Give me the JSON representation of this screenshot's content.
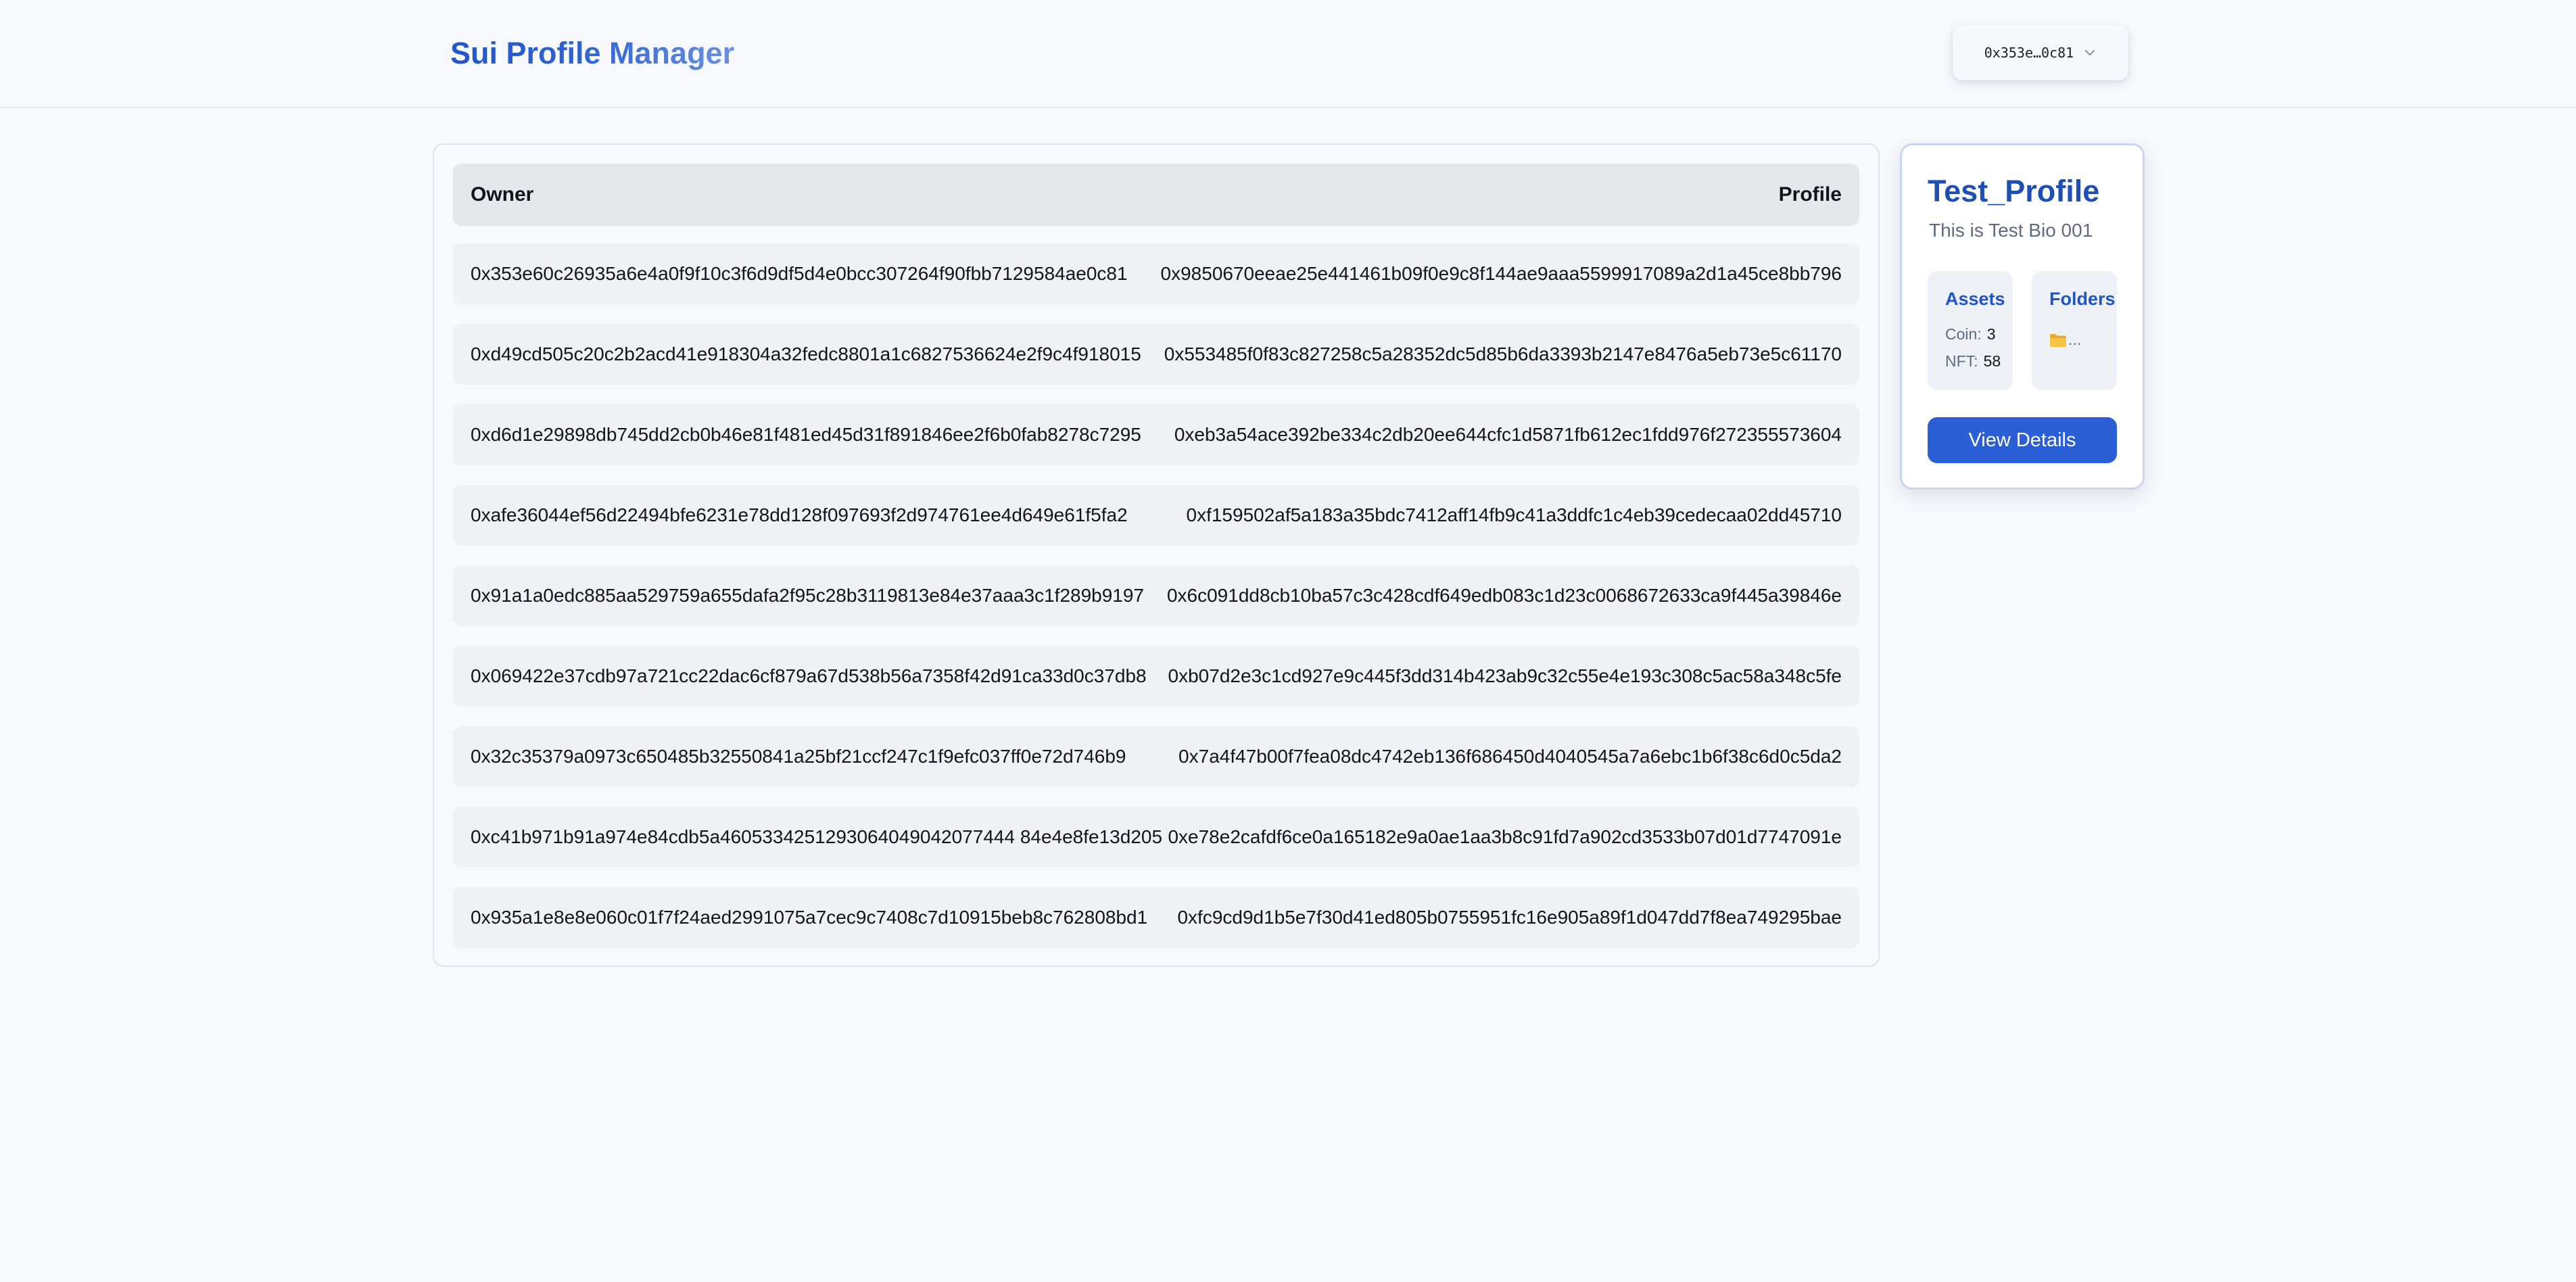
{
  "header": {
    "title": "Sui Profile Manager",
    "wallet_address": "0x353e…0c81",
    "wallet_icon": "chevron-down-icon"
  },
  "table": {
    "columns": [
      "Owner",
      "Profile"
    ],
    "rows": [
      {
        "owner": "0x353e60c26935a6e4a0f9f10c3f6d9df5d4e0bcc307264f90fbb7129584ae0c81",
        "profile": "0x9850670eeae25e441461b09f0e9c8f144ae9aaa5599917089a2d1a45ce8bb796"
      },
      {
        "owner": "0xd49cd505c20c2b2acd41e918304a32fedc8801a1c6827536624e2f9c4f918015",
        "profile": "0x553485f0f83c827258c5a28352dc5d85b6da3393b2147e8476a5eb73e5c61170"
      },
      {
        "owner": "0xd6d1e29898db745dd2cb0b46e81f481ed45d31f891846ee2f6b0fab8278c7295",
        "profile": "0xeb3a54ace392be334c2db20ee644cfc1d5871fb612ec1fdd976f272355573604"
      },
      {
        "owner": "0xafe36044ef56d22494bfe6231e78dd128f097693f2d974761ee4d649e61f5fa2",
        "profile": "0xf159502af5a183a35bdc7412aff14fb9c41a3ddfc1c4eb39cedecaa02dd45710"
      },
      {
        "owner": "0x91a1a0edc885aa529759a655dafa2f95c28b3119813e84e37aaa3c1f289b9197",
        "profile": "0x6c091dd8cb10ba57c3c428cdf649edb083c1d23c0068672633ca9f445a39846e"
      },
      {
        "owner": "0x069422e37cdb97a721cc22dac6cf879a67d538b56a7358f42d91ca33d0c37db8",
        "profile": "0xb07d2e3c1cd927e9c445f3dd314b423ab9c32c55e4e193c308c5ac58a348c5fe"
      },
      {
        "owner": "0x32c35379a0973c650485b32550841a25bf21ccf247c1f9efc037ff0e72d746b9",
        "profile": "0x7a4f47b00f7fea08dc4742eb136f686450d4040545a7a6ebc1b6f38c6d0c5da2"
      },
      {
        "owner": "0xc41b971b91a974e84cdb5a4605334251293064049042077444 84e4e8fe13d205",
        "profile": "0xe78e2cafdf6ce0a165182e9a0ae1aa3b8c91fd7a902cd3533b07d01d7747091e"
      },
      {
        "owner": "0x935a1e8e8e060c01f7f24aed2991075a7cec9c7408c7d10915beb8c762808bd1",
        "profile": "0xfc9cd9d1b5e7f30d41ed805b0755951fc16e905a89f1d047dd7f8ea749295bae"
      }
    ]
  },
  "profile_card": {
    "name": "Test_Profile",
    "bio": "This is Test Bio 001",
    "assets": {
      "title": "Assets",
      "coin_label": "Coin:",
      "coin_value": "3",
      "nft_label": "NFT:",
      "nft_value": "58"
    },
    "folders": {
      "title": "Folders",
      "icon": "folder-icon",
      "text": "..."
    },
    "button_label": "View Details"
  },
  "colors": {
    "brand_blue": "#2a5fd6",
    "title_blue": "#1f4fb3",
    "page_bg": "#f7f9fc",
    "row_bg": "#eff1f4",
    "header_row_bg": "#e6e7ea",
    "folder_yellow": "#f5c242"
  }
}
